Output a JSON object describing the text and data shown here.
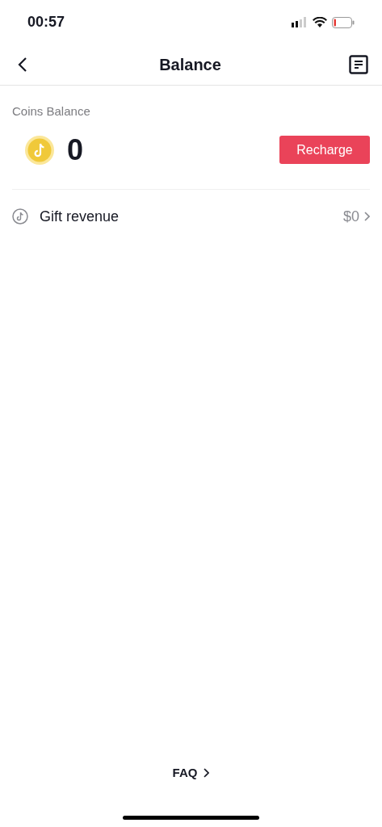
{
  "status_bar": {
    "time": "00:57"
  },
  "header": {
    "title": "Balance"
  },
  "coins": {
    "label": "Coins Balance",
    "amount": "0",
    "button": "Recharge"
  },
  "gift_revenue": {
    "label": "Gift revenue",
    "value": "$0"
  },
  "footer": {
    "link": "FAQ"
  }
}
